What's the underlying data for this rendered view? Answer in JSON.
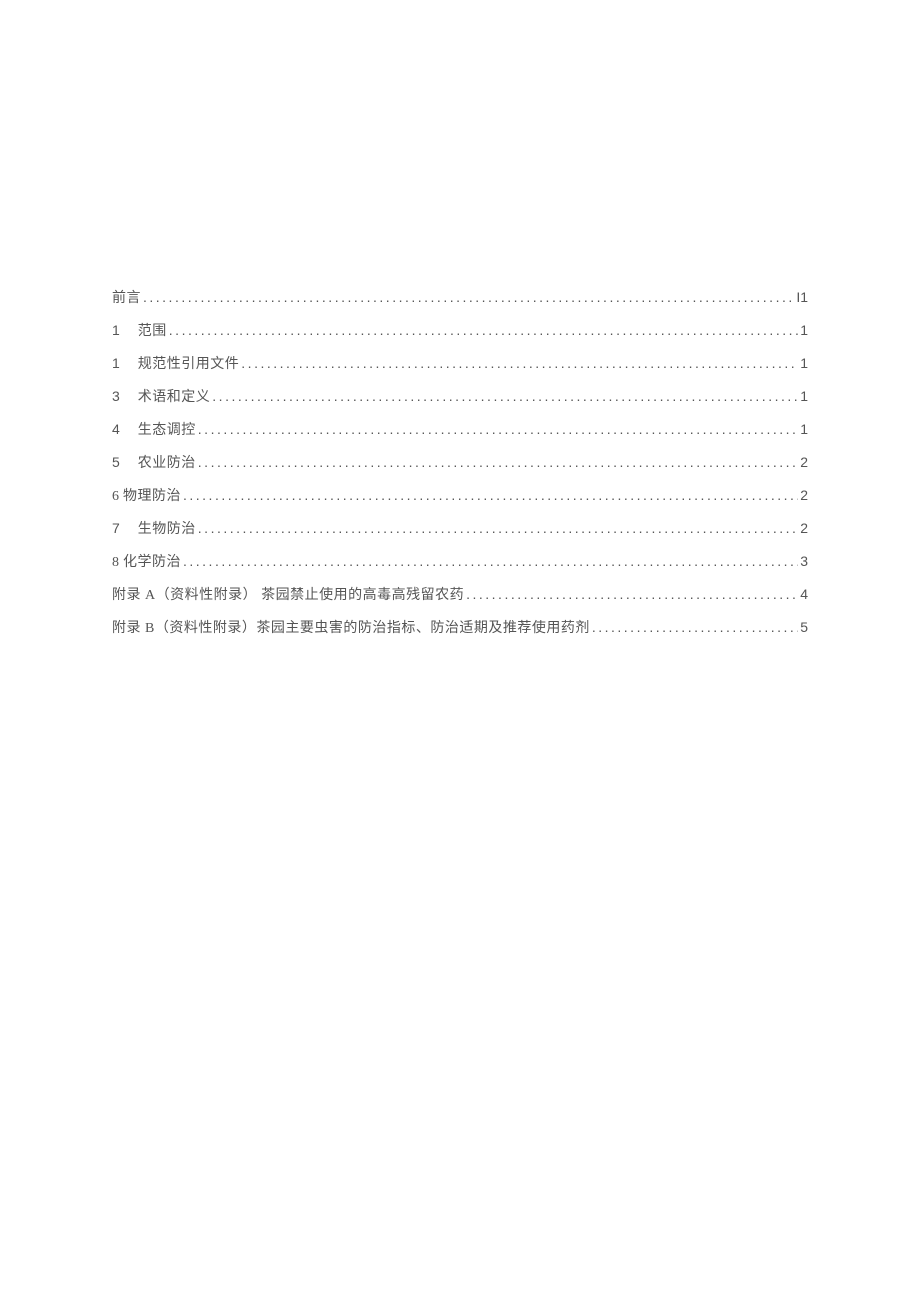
{
  "toc": [
    {
      "num": "",
      "numClass": "",
      "label": "前言",
      "page": "I1"
    },
    {
      "num": "1",
      "numClass": "toc-num",
      "label": "范围",
      "page": "1"
    },
    {
      "num": "1",
      "numClass": "toc-num",
      "label": "规范性引用文件",
      "page": "1"
    },
    {
      "num": "3",
      "numClass": "toc-num",
      "label": "术语和定义",
      "page": "1"
    },
    {
      "num": "4",
      "numClass": "toc-num",
      "label": "生态调控",
      "page": "1"
    },
    {
      "num": "5",
      "numClass": "toc-num",
      "label": "农业防治",
      "page": "2"
    },
    {
      "num": "6",
      "numClass": "toc-num-tight",
      "label": "物理防治",
      "page": "2"
    },
    {
      "num": "7",
      "numClass": "toc-num",
      "label": "生物防治",
      "page": "2"
    },
    {
      "num": "8",
      "numClass": "toc-num-tight",
      "label": "化学防治",
      "page": "3"
    },
    {
      "num": "",
      "numClass": "",
      "label": "附录 A（资料性附录） 茶园禁止使用的高毒高残留农药",
      "page": "4"
    },
    {
      "num": "",
      "numClass": "",
      "label": "附录 B（资料性附录）茶园主要虫害的防治指标、防治适期及推荐使用药剂",
      "page": "5"
    }
  ]
}
